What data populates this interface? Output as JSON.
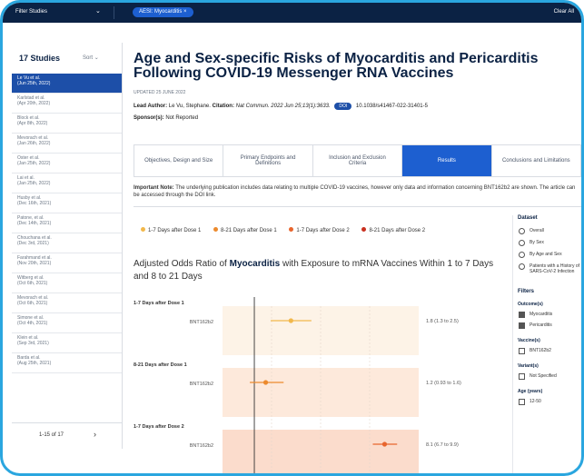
{
  "topbar": {
    "filter_label": "Filter Studies",
    "chip_label": "AESI: Myocarditis",
    "chip_close": "×",
    "clear_all": "Clear All"
  },
  "sidebar": {
    "count": "17 Studies",
    "sort": "Sort",
    "items": [
      {
        "name": "Le Vu et al.",
        "date": "(Jun 25th, 2022)"
      },
      {
        "name": "Karlstad et al.",
        "date": "(Apr 20th, 2022)"
      },
      {
        "name": "Block et al.",
        "date": "(Apr 8th, 2022)"
      },
      {
        "name": "Mevorach et al.",
        "date": "(Jan 26th, 2022)"
      },
      {
        "name": "Oster et al.",
        "date": "(Jan 25th, 2022)"
      },
      {
        "name": "Lai et al.",
        "date": "(Jan 25th, 2022)"
      },
      {
        "name": "Husby et al.",
        "date": "(Dec 16th, 2021)"
      },
      {
        "name": "Patone, et al.",
        "date": "(Dec 14th, 2021)"
      },
      {
        "name": "Chouchana et al.",
        "date": "(Dec 3rd, 2021)"
      },
      {
        "name": "Farahmand et al.",
        "date": "(Nov 20th, 2021)"
      },
      {
        "name": "Witberg et al.",
        "date": "(Oct 6th, 2021)"
      },
      {
        "name": "Mevorach et al.",
        "date": "(Oct 6th, 2021)"
      },
      {
        "name": "Simone et al.",
        "date": "(Oct 4th, 2021)"
      },
      {
        "name": "Klein et al.",
        "date": "(Sep 3rd, 2021)"
      },
      {
        "name": "Barda et al.",
        "date": "(Aug 25th, 2021)"
      }
    ],
    "pager": "1-15 of 17",
    "pager_next": "›"
  },
  "article": {
    "title": "Age and Sex-specific Risks of Myocarditis and Pericarditis Following COVID-19 Messenger RNA Vaccines",
    "updated": "UPDATED 25 JUNE 2022",
    "lead_author_label": "Lead Author:",
    "lead_author": "Le Vu, Stephane.",
    "citation_label": "Citation:",
    "citation": "Nat Commun. 2022 Jun 25;13(1):3633.",
    "doi_label": "DOI",
    "doi": "10.1038/s41467-022-31401-5",
    "sponsor_label": "Sponsor(s):",
    "sponsor": "Not Reported"
  },
  "tabs": [
    "Objectives, Design and Size",
    "Primary Endpoints and Definitions",
    "Inclusion and Exclusion Criteria",
    "Results",
    "Conclusions and Limitations"
  ],
  "note": {
    "label": "Important Note:",
    "text": "The underlying publication includes data relating to multiple COVID-19 vaccines, however only data and information concerning BNT162b2 are shown. The article can be accessed through the DOI link."
  },
  "legend": [
    {
      "label": "1-7 Days after Dose 1",
      "color": "#f2b84b"
    },
    {
      "label": "8-21 Days after Dose 1",
      "color": "#ec8a2d"
    },
    {
      "label": "1-7 Days after Dose 2",
      "color": "#e8652d"
    },
    {
      "label": "8-21 Days after Dose 2",
      "color": "#c9301f"
    }
  ],
  "chart_title": {
    "prefix": "Adjusted Odds Ratio of",
    "highlight": "Myocarditis",
    "suffix": "with Exposure to mRNA Vaccines Within 1 to 7 Days and 8 to 21 Days"
  },
  "chart_data": {
    "type": "scatter",
    "title": "Adjusted Odds Ratio of Myocarditis with Exposure to mRNA Vaccines Within 1 to 7 Days and 8 to 21 Days",
    "groups": [
      {
        "label": "1-7 Days after Dose 1",
        "row": "BNT162b2",
        "or": 1.8,
        "ci": [
          1.3,
          2.5
        ],
        "text": "1.8 (1.3 to 2.5)",
        "color": "#f2b84b",
        "band": "#fdf3e7"
      },
      {
        "label": "8-21 Days after Dose 1",
        "row": "BNT162b2",
        "or": 1.2,
        "ci": [
          0.93,
          1.6
        ],
        "text": "1.2 (0.93 to 1.6)",
        "color": "#ec8a2d",
        "band": "#fde9db"
      },
      {
        "label": "1-7 Days after Dose 2",
        "row": "BNT162b2",
        "or": 8.1,
        "ci": [
          6.7,
          9.9
        ],
        "text": "8.1 (6.7 to 9.9)",
        "color": "#e8652d",
        "band": "#fbdccc"
      }
    ],
    "reference_line": 1,
    "xscale": "log"
  },
  "panel": {
    "dataset_label": "Dataset",
    "dataset_options": [
      "Overall",
      "By Sex",
      "By Age and Sex",
      "Patients with a History of SARS-CoV-2 Infection"
    ],
    "filters_label": "Filters",
    "outcome_label": "Outcome(s)",
    "outcomes": [
      "Myocarditis",
      "Pericarditis"
    ],
    "vaccine_label": "Vaccine(s)",
    "vaccines": [
      "BNT162b2"
    ],
    "variant_label": "Variant(s)",
    "variants": [
      "Not Specified"
    ],
    "age_label": "Age (years)",
    "ages": [
      "12-50"
    ]
  }
}
